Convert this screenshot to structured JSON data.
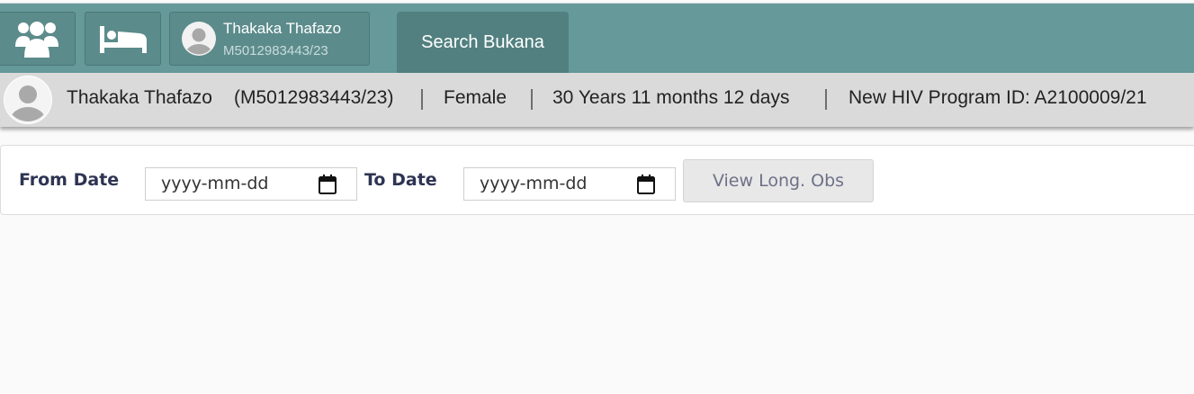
{
  "header": {
    "nav_buttons": [
      {
        "icon": "patients-group-icon"
      },
      {
        "icon": "bed-icon"
      }
    ],
    "current_patient": {
      "name": "Thakaka Thafazo",
      "id": "M5012983443/23",
      "icon": "user-avatar-icon"
    },
    "search_tab_label": "Search Bukana"
  },
  "patient_bar": {
    "name": "Thakaka Thafazo",
    "id_display": "(M5012983443/23)",
    "gender": "Female",
    "age": "30 Years 11 months 12 days",
    "program_id": "New HIV Program ID: A2100009/21"
  },
  "filters": {
    "from_label": "From Date",
    "from_placeholder": "yyyy-mm-dd",
    "to_label": "To Date",
    "to_placeholder": "yyyy-mm-dd",
    "view_button_label": "View Long. Obs"
  },
  "colors": {
    "topbar": "#669999",
    "active_tab": "#528080",
    "patient_bar": "#dadada"
  }
}
